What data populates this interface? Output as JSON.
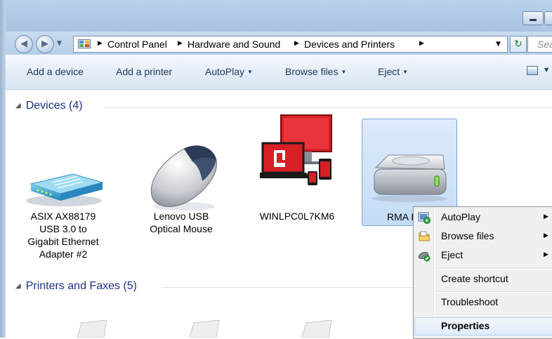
{
  "breadcrumb": [
    "Control Panel",
    "Hardware and Sound",
    "Devices and Printers"
  ],
  "search": {
    "placeholder": "Sea"
  },
  "toolbar": {
    "add_device": "Add a device",
    "add_printer": "Add a printer",
    "autoplay": "AutoPlay",
    "browse_files": "Browse files",
    "eject": "Eject"
  },
  "groups": {
    "devices": "Devices (4)",
    "printers": "Printers and Faxes (5)"
  },
  "devices": [
    {
      "lines": [
        "ASIX AX88179",
        "USB 3.0 to",
        "Gigabit Ethernet",
        "Adapter #2"
      ],
      "icon": "network-adapter-icon"
    },
    {
      "lines": [
        "Lenovo USB",
        "Optical Mouse"
      ],
      "icon": "mouse-icon"
    },
    {
      "lines": [
        "WINLPC0L7KM6"
      ],
      "icon": "computer-icon"
    },
    {
      "lines": [
        "RMA I"
      ],
      "icon": "hard-drive-icon"
    }
  ],
  "context_menu": {
    "autoplay": "AutoPlay",
    "browse_files": "Browse files",
    "eject": "Eject",
    "create_shortcut": "Create shortcut",
    "troubleshoot": "Troubleshoot",
    "properties": "Properties"
  },
  "colors": {
    "group_header": "#1e3287",
    "toolbar_text": "#1e395b",
    "selection": "#c5dcf6",
    "accent_red": "#d71f26"
  }
}
